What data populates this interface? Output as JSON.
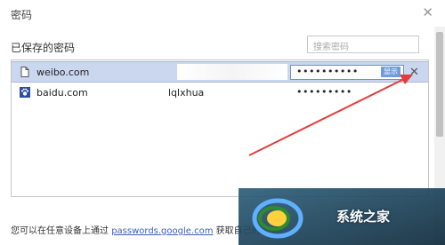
{
  "dialog": {
    "title": "密码"
  },
  "section": {
    "title": "已保存的密码"
  },
  "search": {
    "placeholder": "搜索密码"
  },
  "rows": [
    {
      "site": "weibo.com",
      "username": "",
      "password": "••••••••••",
      "show_label": "显示"
    },
    {
      "site": "baidu.com",
      "username": "lqlxhua",
      "password": "•••••••••"
    }
  ],
  "footer": {
    "prefix": "您可以在任意设备上通过 ",
    "link": "passwords.google.com",
    "suffix": " 获取自己的密"
  },
  "watermark": {
    "text": "系统之家"
  },
  "colors": {
    "selected_row": "#cad7ef",
    "link": "#3b5fb5",
    "arrow": "#e33c3c"
  }
}
